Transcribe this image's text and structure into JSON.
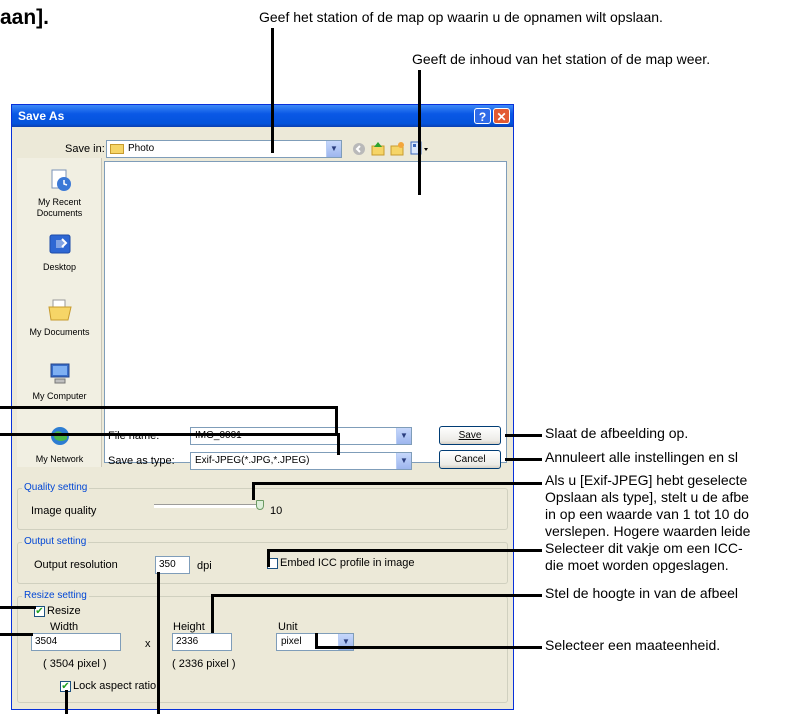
{
  "page": {
    "heading": "aan].",
    "callouts": {
      "save_in": "Geef het station of de map op waarin u de opnamen wilt opslaan.",
      "contents": "Geeft de inhoud van het station of de map weer.",
      "save": "Slaat de afbeelding op.",
      "cancel": "Annuleert alle instellingen en sl",
      "quality": [
        "Als u [Exif-JPEG] hebt geselecte",
        "Opslaan als type], stelt u de afbe",
        "in op een waarde van 1 tot 10 do",
        "verslepen. Hogere waarden leide"
      ],
      "icc": [
        "Selecteer dit vakje om een ICC-",
        "die moet worden opgeslagen."
      ],
      "height": "Stel de hoogte in van de afbeel",
      "unit": "Selecteer een maateenheid."
    }
  },
  "dialog": {
    "title": "Save As",
    "help_glyph": "?",
    "close_glyph": "✕",
    "save_in_label": "Save in:",
    "save_in_value": "Photo",
    "places": [
      {
        "label": "My Recent Documents",
        "icon": "recent-documents-icon"
      },
      {
        "label": "Desktop",
        "icon": "desktop-icon"
      },
      {
        "label": "My Documents",
        "icon": "my-documents-icon"
      },
      {
        "label": "My Computer",
        "icon": "my-computer-icon"
      },
      {
        "label": "My Network",
        "icon": "my-network-icon"
      }
    ],
    "file_name_label": "File name:",
    "file_name_value": "IMG_0001",
    "save_type_label": "Save as type:",
    "save_type_value": "Exif-JPEG(*.JPG,*.JPEG)",
    "save_button": "Save",
    "cancel_button": "Cancel",
    "quality": {
      "group_label": "Quality setting",
      "label": "Image quality",
      "value": "10",
      "level": 10,
      "max": 10
    },
    "output": {
      "group_label": "Output setting",
      "resolution_label": "Output resolution",
      "resolution_value": "350",
      "unit": "dpi",
      "embed_icc_label": "Embed ICC profile in image",
      "embed_icc_checked": false
    },
    "resize": {
      "group_label": "Resize setting",
      "resize_label": "Resize",
      "resize_checked": true,
      "width_label": "Width",
      "width_value": "3504",
      "width_pixels": "( 3504 pixel )",
      "times": "x",
      "height_label": "Height",
      "height_value": "2336",
      "height_pixels": "( 2336 pixel )",
      "unit_label": "Unit",
      "unit_value": "pixel",
      "lock_label": "Lock aspect ratio",
      "lock_checked": true
    }
  }
}
